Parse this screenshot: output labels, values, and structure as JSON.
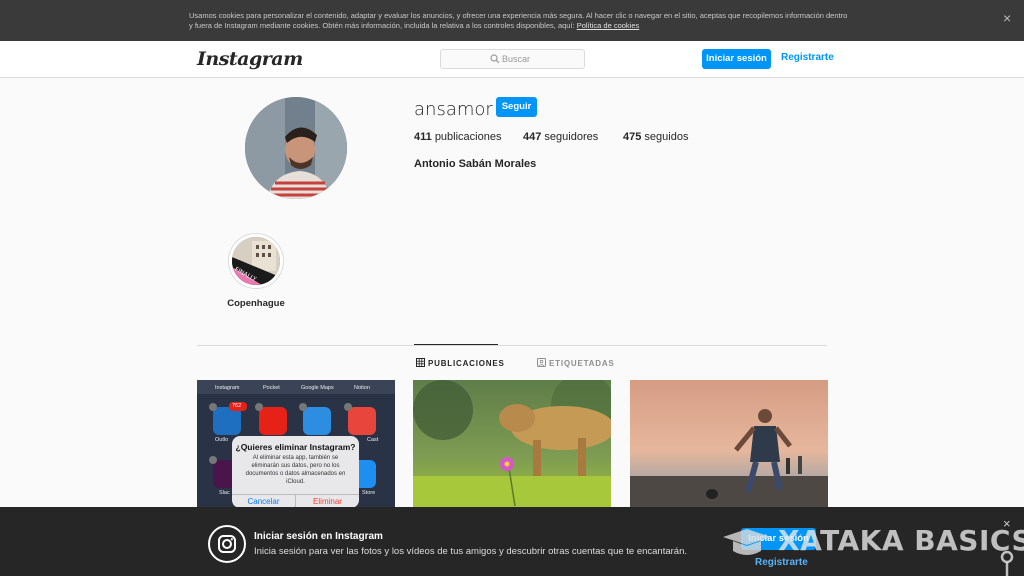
{
  "cookie_bar": {
    "text": "Usamos cookies para personalizar el contenido, adaptar y evaluar los anuncios, y ofrecer una experiencia más segura. Al hacer clic o navegar en el sitio, aceptas que recopilemos información dentro y fuera de Instagram mediante cookies. Obtén más información, incluida la relativa a los controles disponibles, aquí: ",
    "link": "Política de cookies",
    "close": "×"
  },
  "header": {
    "logo": "Instagram",
    "search_placeholder": "Buscar",
    "login_label": "Iniciar sesión",
    "register_label": "Registrarte"
  },
  "profile": {
    "username": "ansamor",
    "follow_label": "Seguir",
    "posts_count": "411",
    "posts_label": "publicaciones",
    "followers_count": "447",
    "followers_label": "seguidores",
    "following_count": "475",
    "following_label": "seguidos",
    "full_name": "Antonio Sabán Morales"
  },
  "highlights": [
    {
      "label": "Copenhague"
    }
  ],
  "tabs": {
    "posts": "PUBLICACIONES",
    "tagged": "ETIQUETADAS"
  },
  "posts": {
    "dialog_title": "¿Quieres eliminar Instagram?",
    "dialog_body": "Al eliminar esta app, también se eliminarán sus datos, pero no los documentos o datos almacenados en iCloud.",
    "dialog_cancel": "Cancelar",
    "dialog_delete": "Eliminar",
    "apps": [
      "Instagram",
      "Pocket",
      "Google Maps",
      "Notion",
      "Outlo",
      "Cast",
      "Slac",
      "Store"
    ],
    "badge": "762"
  },
  "banner": {
    "title": "Iniciar sesión en Instagram",
    "text": "Inicia sesión para ver las fotos y los vídeos de tus amigos y descubrir otras cuentas que te encantarán.",
    "login_label": "Iniciar sesión",
    "register_label": "Registrarte",
    "close": "×"
  },
  "watermark": "XATAKA BASICS",
  "colors": {
    "accent": "#0095f6",
    "cookie_bg": "#3a3a3a",
    "banner_bg": "#262626"
  }
}
